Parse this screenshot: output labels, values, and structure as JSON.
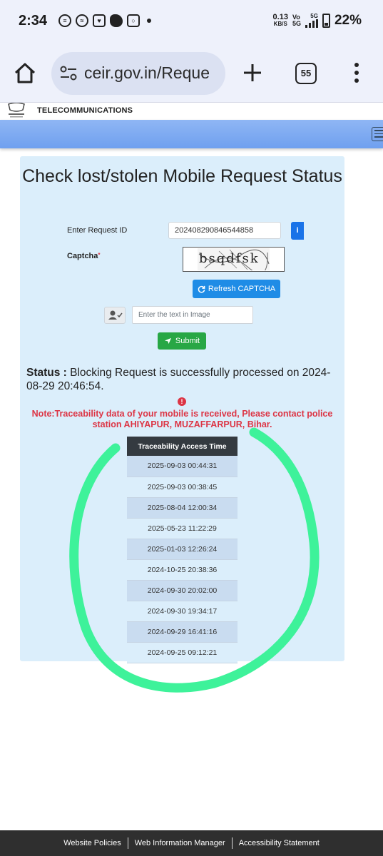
{
  "status_bar": {
    "time": "2:34",
    "net_speed_value": "0.13",
    "net_speed_unit": "KB/S",
    "vo_label": "Vo",
    "vo_sub": "5G",
    "network": "5G",
    "battery": "22%",
    "tabs_count": "55"
  },
  "browser": {
    "url": "ceir.gov.in/Reque"
  },
  "site": {
    "org_name": "TELECOMMUNICATIONS"
  },
  "card": {
    "title": "Check lost/stolen Mobile Request Status",
    "request_id_label": "Enter Request ID",
    "request_id_value": "202408290846544858",
    "captcha_label": "Captcha",
    "captcha_required_mark": "*",
    "captcha_image_text": "bsqdfsk",
    "refresh_label": "Refresh CAPTCHA",
    "captcha_input_placeholder": "Enter the text in Image",
    "submit_label": "Submit",
    "status_prefix": "Status :",
    "status_message": " Blocking Request is successfully processed on 2024-08-29 20:46:54.",
    "note": "Note:Traceability data of your mobile is received, Please contact police station AHIYAPUR, MUZAFFARPUR, Bihar.",
    "table": {
      "header": "Traceability Access Time",
      "rows": [
        "2025-09-03 00:44:31",
        "2025-09-03 00:38:45",
        "2025-08-04 12:00:34",
        "2025-05-23 11:22:29",
        "2025-01-03 12:26:24",
        "2024-10-25 20:38:36",
        "2024-09-30 20:02:00",
        "2024-09-30 19:34:17",
        "2024-09-29 16:41:16",
        "2024-09-25 09:12:21"
      ]
    }
  },
  "footer": {
    "links": [
      "Website Policies",
      "Web Information Manager",
      "Accessibility Statement"
    ]
  },
  "colors": {
    "annotation_circle": "#3ef29a",
    "note_red": "#dc3545",
    "card_bg": "#dbeefb",
    "table_header": "#343a40"
  }
}
